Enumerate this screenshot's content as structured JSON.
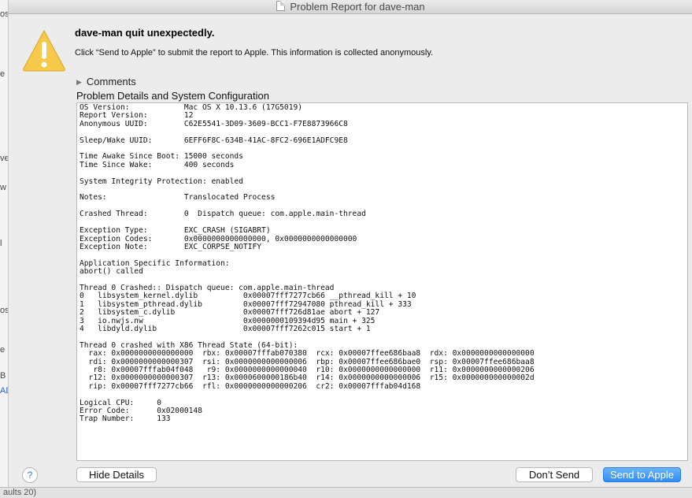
{
  "window": {
    "title": "Problem Report for dave-man"
  },
  "header": {
    "headline": "dave-man quit unexpectedly.",
    "subtext": "Click “Send to Apple” to submit the report to Apple. This information is collected anonymously."
  },
  "comments": {
    "label": "Comments"
  },
  "details": {
    "title": "Problem Details and System Configuration",
    "lines": [
      "OS Version:            Mac OS X 10.13.6 (17G5019)",
      "Report Version:        12",
      "Anonymous UUID:        C62E5541-3D09-3609-BCC1-F7E8873966C8",
      "",
      "Sleep/Wake UUID:       6EFF6F8C-634B-41AC-8FC2-696E1ADFC9E8",
      "",
      "Time Awake Since Boot: 15000 seconds",
      "Time Since Wake:       400 seconds",
      "",
      "System Integrity Protection: enabled",
      "",
      "Notes:                 Translocated Process",
      "",
      "Crashed Thread:        0  Dispatch queue: com.apple.main-thread",
      "",
      "Exception Type:        EXC_CRASH (SIGABRT)",
      "Exception Codes:       0x0000000000000000, 0x0000000000000000",
      "Exception Note:        EXC_CORPSE_NOTIFY",
      "",
      "Application Specific Information:",
      "abort() called",
      "",
      "Thread 0 Crashed:: Dispatch queue: com.apple.main-thread",
      "0   libsystem_kernel.dylib          0x00007fff7277cb66 __pthread_kill + 10",
      "1   libsystem_pthread.dylib         0x00007fff72947080 pthread_kill + 333",
      "2   libsystem_c.dylib               0x00007fff726d81ae abort + 127",
      "3   io.nwjs.nw                      0x0000000109394d95 main + 325",
      "4   libdyld.dylib                   0x00007fff7262c015 start + 1",
      "",
      "Thread 0 crashed with X86 Thread State (64-bit):",
      "  rax: 0x0000000000000000  rbx: 0x00007fffab070380  rcx: 0x00007ffee686baa8  rdx: 0x0000000000000000",
      "  rdi: 0x0000000000000307  rsi: 0x0000000000000006  rbp: 0x00007ffee686bae0  rsp: 0x00007ffee686baa8",
      "   r8: 0x00007fffab04f048   r9: 0x0000000000000040  r10: 0x0000000000000000  r11: 0x0000000000000206",
      "  r12: 0x0000000000000307  r13: 0x0000600000186b40  r14: 0x0000000000000006  r15: 0x000000000000002d",
      "  rip: 0x00007fff7277cb66  rfl: 0x0000000000000206  cr2: 0x00007fffab04d168",
      "",
      "Logical CPU:     0",
      "Error Code:      0x02000148",
      "Trap Number:     133"
    ]
  },
  "buttons": {
    "help": "?",
    "hide_details": "Hide Details",
    "dont_send": "Don’t Send",
    "send": "Send to Apple"
  },
  "background": {
    "fragments": [
      "os",
      "e",
      "ve",
      "w",
      "l",
      "os",
      "e",
      "B",
      "AD"
    ],
    "bottom": "aults   20)"
  },
  "colors": {
    "accent": "#2d8ef5",
    "warning": "#f5c518"
  }
}
